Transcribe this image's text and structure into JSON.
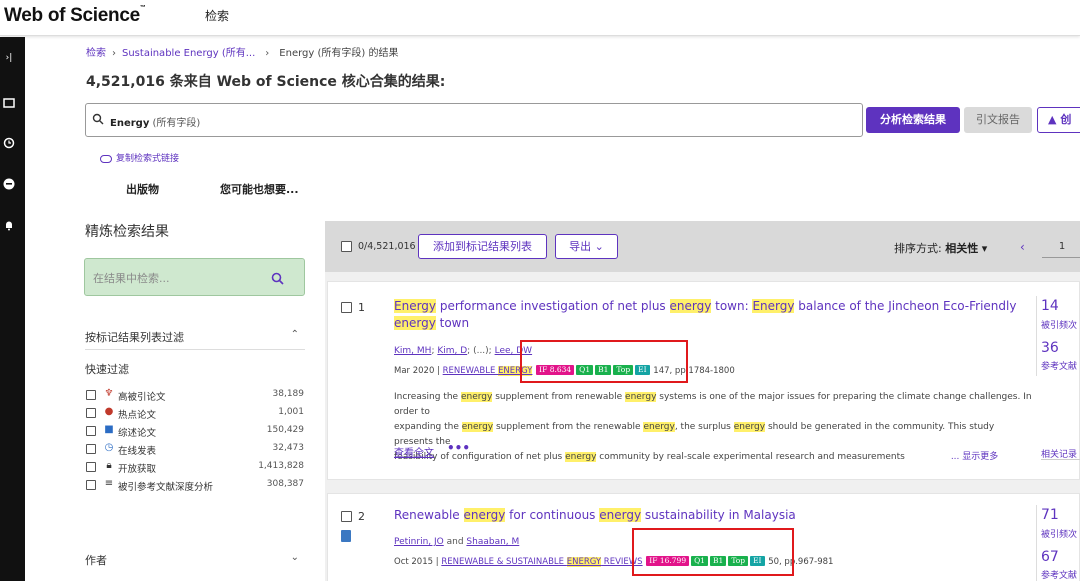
{
  "topbar": {
    "logo": "Web of Science",
    "tm": "™",
    "search_tab": "检索"
  },
  "breadcrumb": {
    "item1": "检索",
    "item2": "Sustainable Energy (所有...",
    "item3": "Energy (所有字段) 的结果"
  },
  "heading": "4,521,016 条来自 Web of Science 核心合集的结果:",
  "search": {
    "term": "Energy",
    "field": "(所有字段)"
  },
  "actions": {
    "analyze": "分析检索结果",
    "citation_report": "引文报告",
    "alert": "创"
  },
  "copy_link": "复制检索式链接",
  "subtabs": {
    "publications": "出版物",
    "you_may_want": "您可能也想要..."
  },
  "refine": {
    "title": "精炼检索结果",
    "filter_placeholder": "在结果中检索...",
    "marked_filter": "按标记结果列表过滤",
    "quick_filter_title": "快速过滤",
    "quick_filters": [
      {
        "label": "高被引论文",
        "count": "38,189",
        "icon": "trophy-icon"
      },
      {
        "label": "热点论文",
        "count": "1,001",
        "icon": "fire-icon"
      },
      {
        "label": "综述论文",
        "count": "150,429",
        "icon": "document-icon"
      },
      {
        "label": "在线发表",
        "count": "32,473",
        "icon": "clock-icon"
      },
      {
        "label": "开放获取",
        "count": "1,413,828",
        "icon": "lock-icon"
      },
      {
        "label": "被引参考文献深度分析",
        "count": "308,387",
        "icon": "list-icon"
      }
    ],
    "author_section": "作者"
  },
  "toolbar": {
    "select_count": "0/4,521,016",
    "add_to_marked": "添加到标记结果列表",
    "export": "导出",
    "sort_label": "排序方式:",
    "sort_value": "相关性",
    "page": "1"
  },
  "results": [
    {
      "num": "1",
      "title_parts": [
        {
          "t": "Energy",
          "h": true
        },
        {
          "t": " performance investigation of net plus ",
          "h": false
        },
        {
          "t": "energy",
          "h": true
        },
        {
          "t": " town: ",
          "h": false
        },
        {
          "t": "Energy",
          "h": true
        },
        {
          "t": " balance of the Jincheon Eco-Friendly ",
          "h": false
        },
        {
          "t": "energy",
          "h": true
        },
        {
          "t": " town",
          "h": false
        }
      ],
      "authors": [
        "Kim, MH",
        "Kim, D",
        "Lee, DW"
      ],
      "authors_sep": "; ",
      "authors_ellipsis": "(...);",
      "date": "Mar 2020",
      "journal_pre": "RENEWABLE ",
      "journal_hl": "ENERGY",
      "badges": {
        "if": "IF 8.634",
        "q": "Q1",
        "b": "B1",
        "top": "Top",
        "ei": "EI"
      },
      "volume": "147",
      "pages": ", pp.1784-1800",
      "abstract_lines": [
        [
          {
            "t": "Increasing the ",
            "h": false
          },
          {
            "t": "energy",
            "h": true
          },
          {
            "t": " supplement from renewable ",
            "h": false
          },
          {
            "t": "energy",
            "h": true
          },
          {
            "t": " systems is one of the major issues for preparing the climate change challenges. In order to",
            "h": false
          }
        ],
        [
          {
            "t": "expanding the ",
            "h": false
          },
          {
            "t": "energy",
            "h": true
          },
          {
            "t": " supplement from the renewable ",
            "h": false
          },
          {
            "t": "energy",
            "h": true
          },
          {
            "t": ", the surplus ",
            "h": false
          },
          {
            "t": "energy",
            "h": true
          },
          {
            "t": " should be generated in the community. This study presents the",
            "h": false
          }
        ],
        [
          {
            "t": "feasibility of configuration of net plus ",
            "h": false
          },
          {
            "t": "energy",
            "h": true
          },
          {
            "t": " community by real-scale experimental research and measurements",
            "h": false
          }
        ]
      ],
      "show_more": "... 显示更多",
      "full_text": "查看全文",
      "times_cited": "14",
      "times_cited_label": "被引频次",
      "references": "36",
      "references_label": "参考文献",
      "related": "相关记录"
    },
    {
      "num": "2",
      "title_parts": [
        {
          "t": "Renewable ",
          "h": false
        },
        {
          "t": "energy",
          "h": true
        },
        {
          "t": " for continuous ",
          "h": false
        },
        {
          "t": "energy",
          "h": true
        },
        {
          "t": " sustainability in Malaysia",
          "h": false
        }
      ],
      "authors": [
        "Petinrin, JO",
        "Shaaban, M"
      ],
      "authors_sep": " and ",
      "date": "Oct 2015",
      "journal_pre": "RENEWABLE & SUSTAINABLE ",
      "journal_hl": "ENERGY",
      "journal_post": " REVIEWS",
      "badges": {
        "if": "IF 16.799",
        "q": "Q1",
        "b": "B1",
        "top": "Top",
        "ei": "EI"
      },
      "volume": "50",
      "pages": ", pp.967-981",
      "times_cited": "71",
      "times_cited_label": "被引频次",
      "references": "67",
      "references_label": "参考文献"
    }
  ]
}
